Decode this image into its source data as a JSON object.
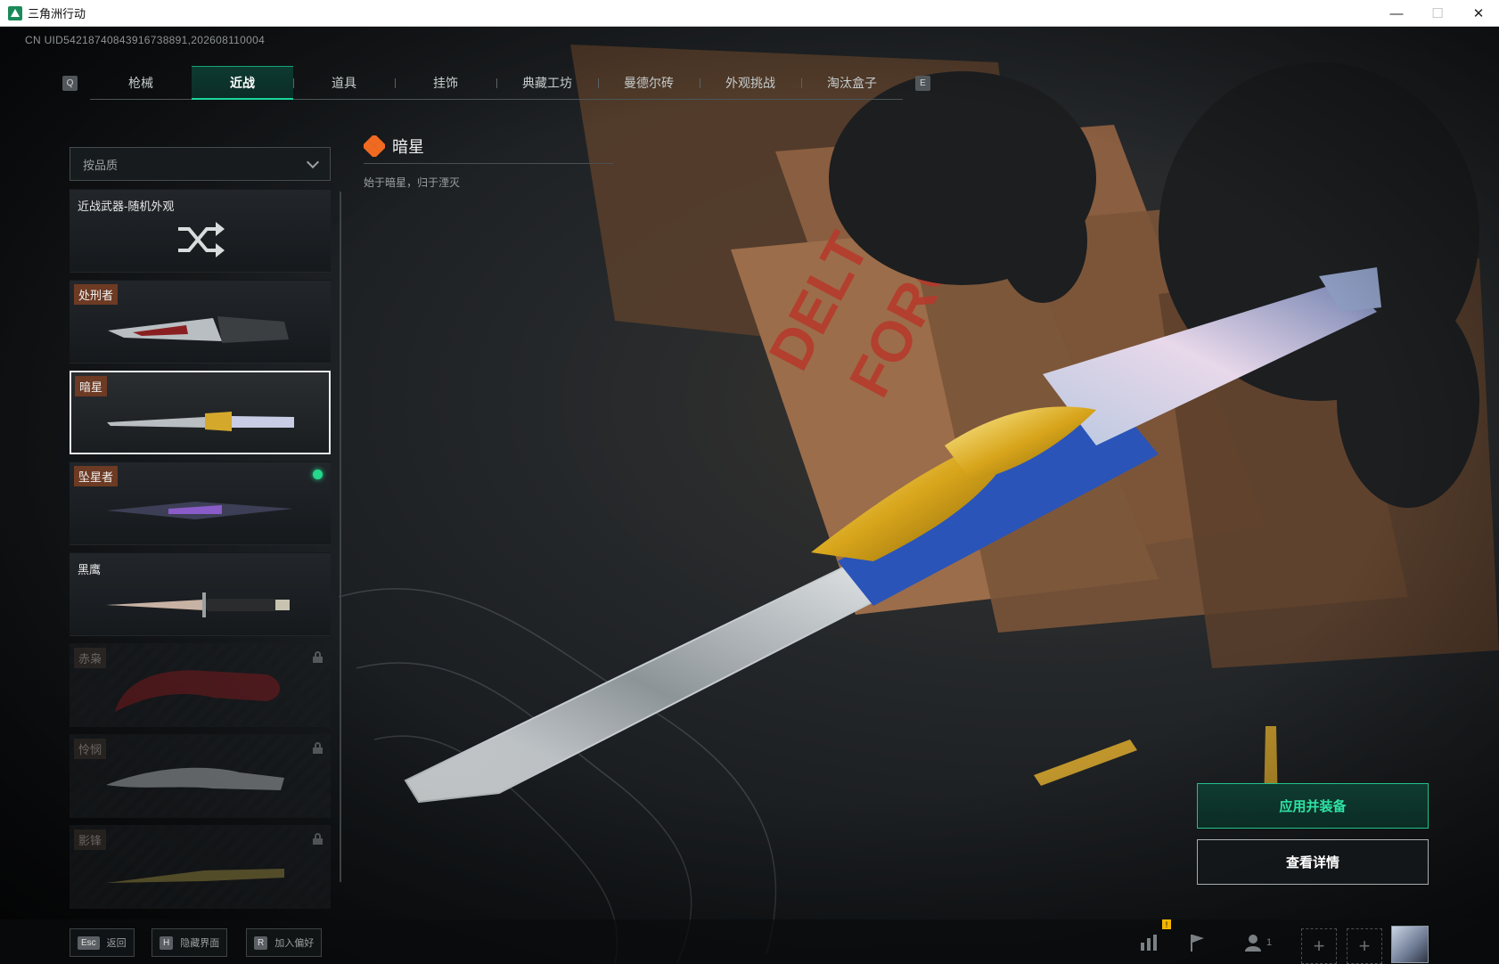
{
  "window": {
    "title": "三角洲行动",
    "minimize_glyph": "—",
    "maximize_glyph": "☐",
    "close_glyph": "✕"
  },
  "uid": "CN UID5421874084391673889​1,202608110004",
  "tabs": {
    "prev_key": "Q",
    "next_key": "E",
    "items": [
      {
        "label": "枪械"
      },
      {
        "label": "近战"
      },
      {
        "label": "道具"
      },
      {
        "label": "挂饰"
      },
      {
        "label": "典藏工坊"
      },
      {
        "label": "曼德尔砖"
      },
      {
        "label": "外观挑战"
      },
      {
        "label": "淘汰盒子"
      }
    ],
    "active_index": 1
  },
  "filter": {
    "sort_label": "按品质"
  },
  "skins": [
    {
      "label": "近战武器-随机外观",
      "icon": "shuffle-icon"
    },
    {
      "label": "处刑者"
    },
    {
      "label": "暗星",
      "selected": true
    },
    {
      "label": "坠星者",
      "equipped": true
    },
    {
      "label": "黑鹰"
    },
    {
      "label": "赤枭",
      "locked": true
    },
    {
      "label": "怜悯",
      "locked": true
    },
    {
      "label": "影锋",
      "locked": true
    }
  ],
  "selected_weapon": {
    "name": "暗星",
    "description": "始于暗星，归于湮灭",
    "icon": "orange-diamond-icon"
  },
  "actions": {
    "apply_label": "应用并装备",
    "detail_label": "查看详情"
  },
  "footer": {
    "back_key": "Esc",
    "back_label": "返回",
    "hide_key": "H",
    "hide_label": "隐藏界面",
    "fav_key": "R",
    "fav_label": "加入偏好",
    "notice_badge": "!",
    "team_count": "1",
    "plus_glyph": "+"
  },
  "colors": {
    "accent_green": "#1ad79a",
    "tier_orange": "#6d3a23",
    "brand_orange": "#f06a21"
  }
}
